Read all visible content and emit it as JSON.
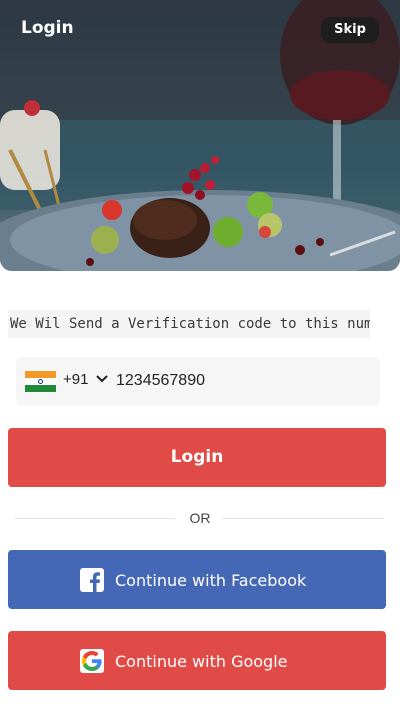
{
  "header": {
    "title": "Login",
    "skip_label": "Skip"
  },
  "verify_message": "We Wil Send a Verification code to this number.",
  "phone": {
    "country_code": "+91",
    "number": "1234567890"
  },
  "login_label": "Login",
  "divider_text": "OR",
  "social": {
    "facebook_label": "Continue with Facebook",
    "google_label": "Continue with Google"
  },
  "colors": {
    "login": "#e04b48",
    "facebook": "#4568b6",
    "google_button": "#e04b48",
    "skip": "#1e1e1e"
  },
  "icons": [
    "india-flag-icon",
    "chevron-down-icon",
    "facebook-icon",
    "google-icon"
  ]
}
